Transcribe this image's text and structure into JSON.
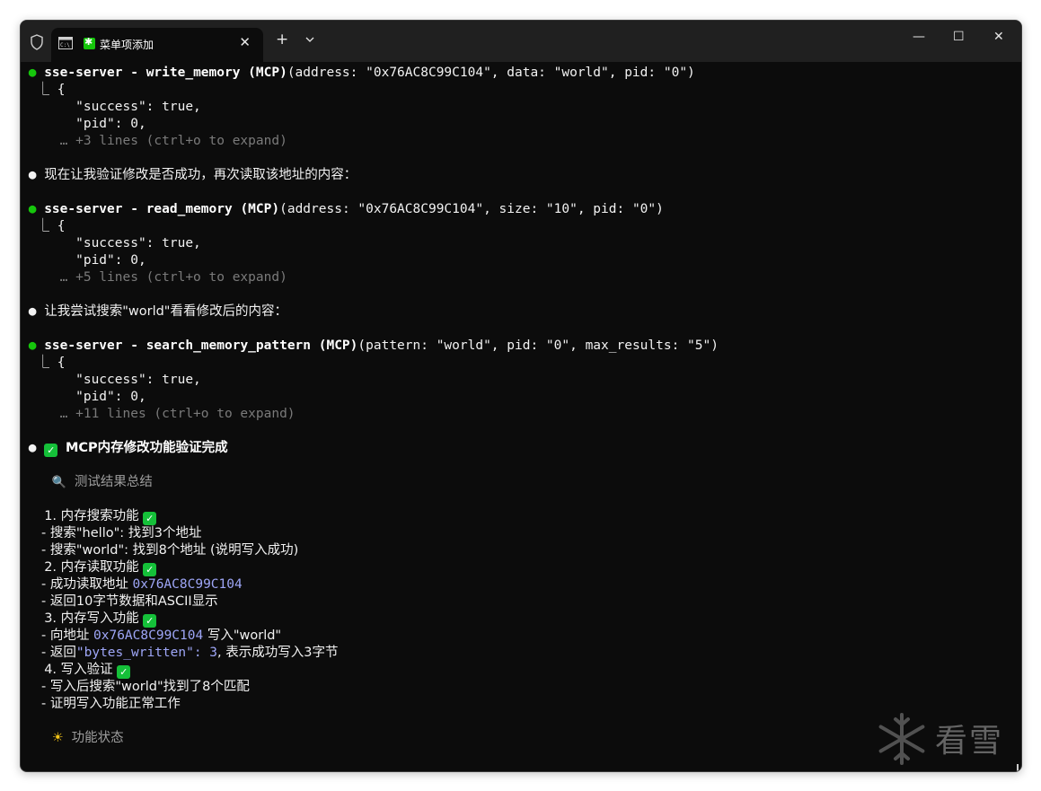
{
  "window": {
    "tab_title": "菜单项添加",
    "close_tab": "✕",
    "new_tab": "+",
    "minimize": "—",
    "maximize": "☐",
    "close": "✕"
  },
  "log": {
    "call1": {
      "bullet": "●",
      "head": "sse-server - write_memory (MCP)",
      "args": "(address: \"0x76AC8C99C104\", data: \"world\", pid: \"0\")",
      "l1": "  ⎿ {",
      "l2": "       \"success\": true,",
      "l3": "       \"pid\": 0,",
      "more": "     … +3 lines (ctrl+o to expand)"
    },
    "msg1": {
      "bullet": "●",
      "text": "现在让我验证修改是否成功，再次读取该地址的内容："
    },
    "call2": {
      "bullet": "●",
      "head": "sse-server - read_memory (MCP)",
      "args": "(address: \"0x76AC8C99C104\", size: \"10\", pid: \"0\")",
      "l1": "  ⎿ {",
      "l2": "       \"success\": true,",
      "l3": "       \"pid\": 0,",
      "more": "     … +5 lines (ctrl+o to expand)"
    },
    "msg2": {
      "bullet": "●",
      "text": "让我尝试搜索\"world\"看看修改后的内容："
    },
    "call3": {
      "bullet": "●",
      "head": "sse-server - search_memory_pattern (MCP)",
      "args": "(pattern: \"world\", pid: \"0\", max_results: \"5\")",
      "l1": "  ⎿ {",
      "l2": "       \"success\": true,",
      "l3": "       \"pid\": 0,",
      "more": "     … +11 lines (ctrl+o to expand)"
    },
    "msg3": {
      "bullet": "●",
      "check": "✓",
      "text": "MCP内存修改功能验证完成"
    },
    "summary_heading": {
      "icon": "🔍",
      "text": "测试结果总结"
    },
    "items": [
      {
        "num": "1. 内存搜索功能 ",
        "lines": [
          "     - 搜索\"hello\": 找到3个地址",
          "     - 搜索\"world\": 找到8个地址 (说明写入成功)"
        ]
      },
      {
        "num": "2. 内存读取功能 ",
        "lines": [
          "     - 成功读取地址 ",
          "     - 返回10字节数据和ASCII显示"
        ],
        "addr": "0x76AC8C99C104"
      },
      {
        "num": "3. 内存写入功能 ",
        "l1a": "     - 向地址 ",
        "l1b": "0x76AC8C99C104",
        "l1c": " 写入\"world\"",
        "l2a": "     - 返回",
        "l2b": "\"bytes_written\": 3",
        "l2c": ", 表示成功写入3字节"
      },
      {
        "num": "4. 写入验证 ",
        "lines": [
          "     - 写入后搜索\"world\"找到了8个匹配",
          "     - 证明写入功能正常工作"
        ]
      }
    ],
    "status_heading": {
      "icon": "☀",
      "text": "功能状态"
    }
  },
  "watermark": {
    "text": "看雪"
  },
  "colors": {
    "bg": "#0c0c0c",
    "titlebar": "#202020",
    "green_dot": "#16c60c",
    "highlight": "#9ea6f7",
    "check": "#15c039"
  }
}
